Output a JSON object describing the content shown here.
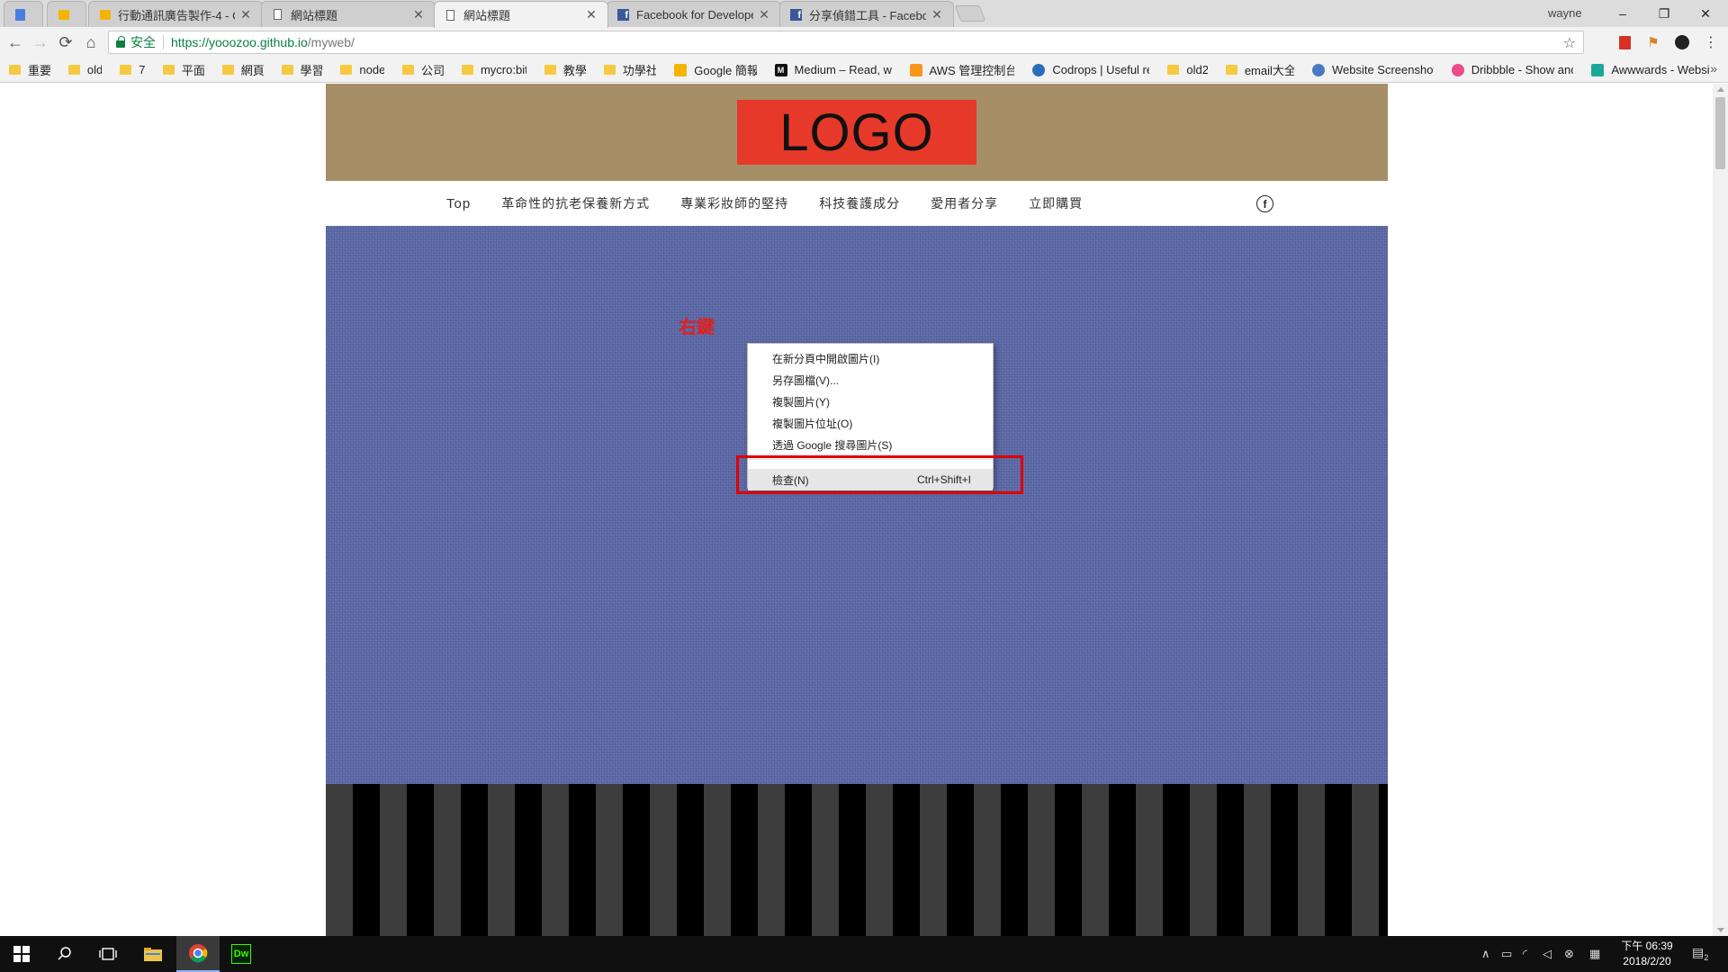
{
  "browser": {
    "tabs": [
      {
        "label": "",
        "icon": "google-docs-icon",
        "active": false
      },
      {
        "label": "",
        "icon": "google-slides-icon",
        "active": false
      },
      {
        "label": "行動通訊廣告製作-4 - Go",
        "icon": "google-slides-icon",
        "active": false
      },
      {
        "label": "網站標題",
        "icon": "page-icon",
        "active": false
      },
      {
        "label": "網站標題",
        "icon": "page-icon",
        "active": true
      },
      {
        "label": "Facebook for Develope",
        "icon": "facebook-icon",
        "active": false
      },
      {
        "label": "分享偵錯工具 - Faceboo",
        "icon": "facebook-icon",
        "active": false
      }
    ],
    "profile_name": "wayne",
    "window_controls": {
      "minimize": "–",
      "restore": "❐",
      "close": "✕"
    },
    "security_label": "安全",
    "url_host": "https://yooozoo.github.io",
    "url_path": "/myweb/",
    "bookmarks": [
      {
        "label": "重要",
        "icon": "folder-icon"
      },
      {
        "label": "old",
        "icon": "folder-icon"
      },
      {
        "label": "7",
        "icon": "folder-icon"
      },
      {
        "label": "平面",
        "icon": "folder-icon"
      },
      {
        "label": "網頁",
        "icon": "folder-icon"
      },
      {
        "label": "學習",
        "icon": "folder-icon"
      },
      {
        "label": "node",
        "icon": "folder-icon"
      },
      {
        "label": "公司",
        "icon": "folder-icon"
      },
      {
        "label": "mycro:bit",
        "icon": "folder-icon"
      },
      {
        "label": "教學",
        "icon": "folder-icon"
      },
      {
        "label": "功學社",
        "icon": "folder-icon"
      },
      {
        "label": "Google 簡報",
        "icon": "google-slides-icon"
      },
      {
        "label": "Medium – Read, wri",
        "icon": "medium-icon"
      },
      {
        "label": "AWS 管理控制台",
        "icon": "aws-icon"
      },
      {
        "label": "Codrops | Useful res",
        "icon": "codrops-icon"
      },
      {
        "label": "old2",
        "icon": "folder-icon"
      },
      {
        "label": "email大全",
        "icon": "folder-icon"
      },
      {
        "label": "Website Screenshot",
        "icon": "globe-icon"
      },
      {
        "label": "Dribbble - Show anc",
        "icon": "dribbble-icon"
      },
      {
        "label": "Awwwards - Websit",
        "icon": "awwwards-icon"
      }
    ]
  },
  "site": {
    "logo_text": "LOGO",
    "nav": [
      "Top",
      "革命性的抗老保養新方式",
      "專業彩妝師的堅持",
      "科技養護成分",
      "愛用者分享",
      "立即購買"
    ],
    "facebook_glyph": "f",
    "annotation_text": "右鍵",
    "colors": {
      "header": "#a68e66",
      "logo_bg": "#e6392a",
      "hero": "#5a67a6",
      "annotation": "#e02020"
    }
  },
  "context_menu": {
    "items": [
      {
        "label": "在新分頁中開啟圖片(I)",
        "shortcut": ""
      },
      {
        "label": "另存圖檔(V)...",
        "shortcut": ""
      },
      {
        "label": "複製圖片(Y)",
        "shortcut": ""
      },
      {
        "label": "複製圖片位址(O)",
        "shortcut": ""
      },
      {
        "label": "透過 Google 搜尋圖片(S)",
        "shortcut": ""
      }
    ],
    "inspect": {
      "label": "檢查(N)",
      "shortcut": "Ctrl+Shift+I"
    }
  },
  "taskbar": {
    "clock_time": "下午 06:39",
    "clock_date": "2018/2/20",
    "notification_count": "2"
  }
}
